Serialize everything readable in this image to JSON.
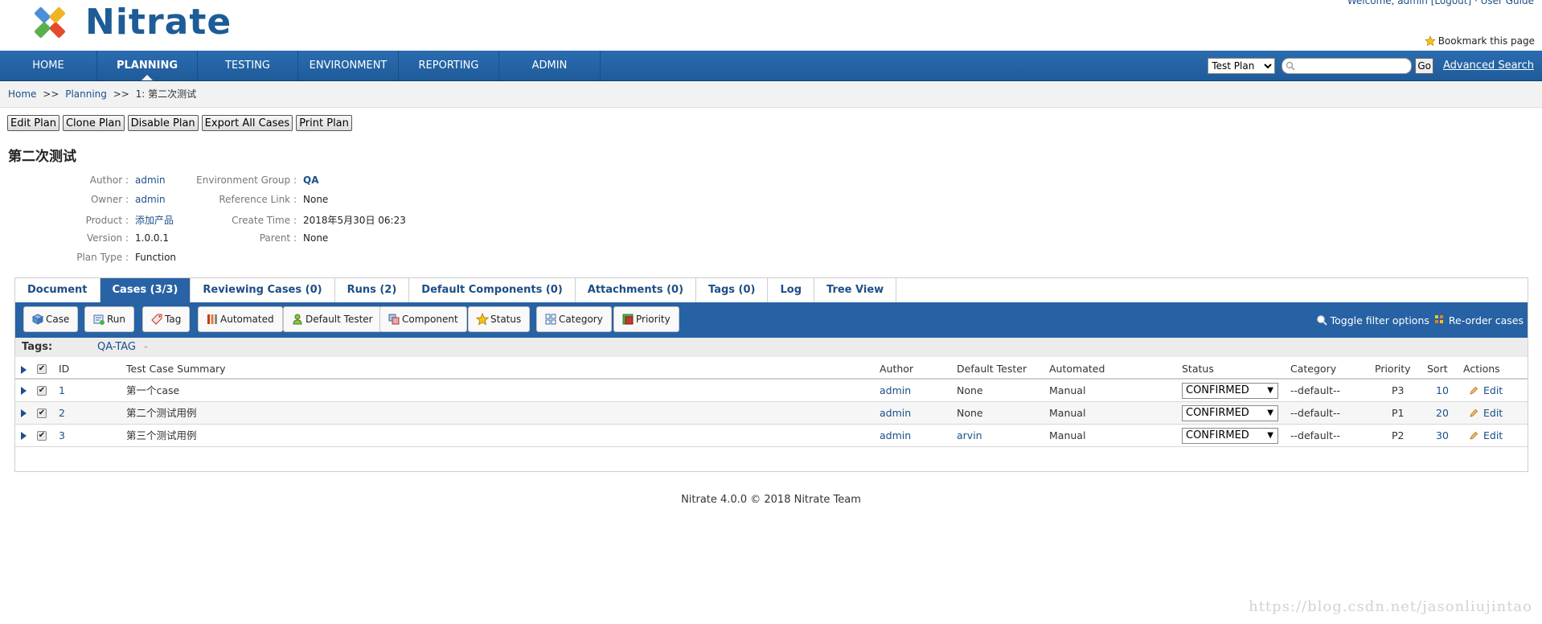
{
  "header": {
    "brand": "Nitrate",
    "topright": "Welcome, admin [Logout]  ·  User Guide",
    "bookmark": "Bookmark this page"
  },
  "nav": {
    "items": [
      "HOME",
      "PLANNING",
      "TESTING",
      "ENVIRONMENT",
      "REPORTING",
      "ADMIN"
    ],
    "active": "PLANNING",
    "search_scope": "Test Plan",
    "search_placeholder": "",
    "go": "Go",
    "advanced": "Advanced Search"
  },
  "breadcrumb": {
    "home": "Home",
    "planning": "Planning",
    "current": "1: 第二次测试",
    "sep": ">>"
  },
  "actions": [
    "Edit Plan",
    "Clone Plan",
    "Disable Plan",
    "Export All Cases",
    "Print Plan"
  ],
  "plan": {
    "title": "第二次测试",
    "author_label": "Author :",
    "author": "admin",
    "owner_label": "Owner :",
    "owner": "admin",
    "product_label": "Product :",
    "product": "添加产品",
    "version_label": "Version :",
    "version": "1.0.0.1",
    "plan_type_label": "Plan Type :",
    "plan_type": "Function",
    "env_group_label": "Environment Group :",
    "env_group": "QA",
    "ref_link_label": "Reference Link :",
    "ref_link": "None",
    "create_time_label": "Create Time :",
    "create_time": "2018年5月30日 06:23",
    "parent_label": "Parent :",
    "parent": "None"
  },
  "tabs": [
    "Document",
    "Cases (3/3)",
    "Reviewing Cases (0)",
    "Runs (2)",
    "Default Components (0)",
    "Attachments (0)",
    "Tags (0)",
    "Log",
    "Tree View"
  ],
  "active_tab": "Cases (3/3)",
  "toolbar": {
    "buttons": [
      {
        "label": "Case",
        "icon": "cube-icon"
      },
      {
        "label": "Run",
        "icon": "run-icon"
      },
      {
        "label": "Tag",
        "icon": "tag-icon"
      },
      {
        "label": "Automated",
        "icon": "automated-icon"
      },
      {
        "label": "Default Tester",
        "icon": "user-icon"
      },
      {
        "label": "Component",
        "icon": "component-icon"
      },
      {
        "label": "Status",
        "icon": "star-icon"
      },
      {
        "label": "Category",
        "icon": "category-icon"
      },
      {
        "label": "Priority",
        "icon": "priority-icon"
      }
    ],
    "toggle_filter": "Toggle filter options",
    "reorder": "Re-order cases"
  },
  "tags_row": {
    "label": "Tags:",
    "value": "QA-TAG",
    "dash": "-"
  },
  "table": {
    "columns": [
      "ID",
      "Test Case Summary",
      "Author",
      "Default Tester",
      "Automated",
      "Status",
      "Category",
      "Priority",
      "Sort",
      "Actions"
    ],
    "rows": [
      {
        "id": "1",
        "summary": "第一个case",
        "author": "admin",
        "tester": "None",
        "automated": "Manual",
        "status": "CONFIRMED",
        "category": "--default--",
        "priority": "P3",
        "sort": "10",
        "action": "Edit"
      },
      {
        "id": "2",
        "summary": "第二个测试用例",
        "author": "admin",
        "tester": "None",
        "automated": "Manual",
        "status": "CONFIRMED",
        "category": "--default--",
        "priority": "P1",
        "sort": "20",
        "action": "Edit"
      },
      {
        "id": "3",
        "summary": "第三个测试用例",
        "author": "admin",
        "tester": "arvin",
        "automated": "Manual",
        "status": "CONFIRMED",
        "category": "--default--",
        "priority": "P2",
        "sort": "30",
        "action": "Edit"
      }
    ]
  },
  "footer": "Nitrate 4.0.0 © 2018 Nitrate Team",
  "watermark": "https://blog.csdn.net/jasonliujintao"
}
